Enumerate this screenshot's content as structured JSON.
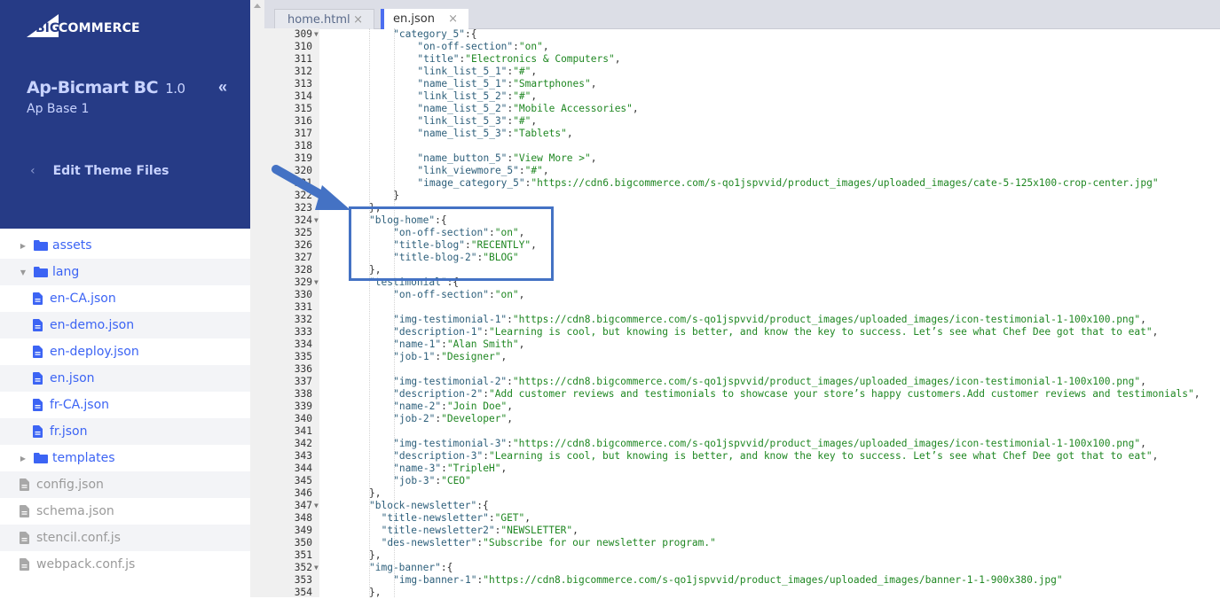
{
  "sidebar": {
    "logo_big": "BIG",
    "logo_text": "COMMERCE",
    "theme_name": "Ap-Bicmart BC",
    "theme_version": "1.0",
    "theme_variant": "Ap Base 1",
    "collapse_icon": "«",
    "back_icon": "‹",
    "edit_files_label": "Edit Theme Files",
    "tree": [
      {
        "label": "assets",
        "type": "folder",
        "expanded": false,
        "level": 0
      },
      {
        "label": "lang",
        "type": "folder",
        "expanded": true,
        "level": 0
      },
      {
        "label": "en-CA.json",
        "type": "file",
        "level": 1
      },
      {
        "label": "en-demo.json",
        "type": "file",
        "level": 1
      },
      {
        "label": "en-deploy.json",
        "type": "file",
        "level": 1
      },
      {
        "label": "en.json",
        "type": "file",
        "level": 1
      },
      {
        "label": "fr-CA.json",
        "type": "file",
        "level": 1
      },
      {
        "label": "fr.json",
        "type": "file",
        "level": 1
      },
      {
        "label": "templates",
        "type": "folder",
        "expanded": false,
        "level": 0
      },
      {
        "label": "config.json",
        "type": "file-muted",
        "level": -1
      },
      {
        "label": "schema.json",
        "type": "file-muted",
        "level": -1
      },
      {
        "label": "stencil.conf.js",
        "type": "file-muted",
        "level": -1
      },
      {
        "label": "webpack.conf.js",
        "type": "file-muted",
        "level": -1
      }
    ]
  },
  "editor": {
    "tabs": [
      {
        "label": "home.html",
        "active": false,
        "close": "×"
      },
      {
        "label": "en.json",
        "active": true,
        "close": "×"
      }
    ],
    "lines": [
      {
        "n": "309",
        "fold": true,
        "indent": 6,
        "key": "\"category_5\"",
        "rest": ":{"
      },
      {
        "n": "310",
        "indent": 7,
        "key": "\"on-off-section\"",
        "val": "\"on\"",
        "end": ","
      },
      {
        "n": "311",
        "indent": 7,
        "key": "\"title\"",
        "val": "\"Electronics & Computers\"",
        "end": ","
      },
      {
        "n": "312",
        "indent": 7,
        "key": "\"link_list_5_1\"",
        "val": "\"#\"",
        "end": ","
      },
      {
        "n": "313",
        "indent": 7,
        "key": "\"name_list_5_1\"",
        "val": "\"Smartphones\"",
        "end": ","
      },
      {
        "n": "314",
        "indent": 7,
        "key": "\"link_list_5_2\"",
        "val": "\"#\"",
        "end": ","
      },
      {
        "n": "315",
        "indent": 7,
        "key": "\"name_list_5_2\"",
        "val": "\"Mobile Accessories\"",
        "end": ","
      },
      {
        "n": "316",
        "indent": 7,
        "key": "\"link_list_5_3\"",
        "val": "\"#\"",
        "end": ","
      },
      {
        "n": "317",
        "indent": 7,
        "key": "\"name_list_5_3\"",
        "val": "\"Tablets\"",
        "end": ","
      },
      {
        "n": "318",
        "indent": 0,
        "rest": ""
      },
      {
        "n": "319",
        "indent": 7,
        "key": "\"name_button_5\"",
        "val": "\"View More >\"",
        "end": ","
      },
      {
        "n": "320",
        "indent": 7,
        "key": "\"link_viewmore_5\"",
        "val": "\"#\"",
        "end": ","
      },
      {
        "n": "321",
        "indent": 7,
        "key": "\"image_category_5\"",
        "val": "\"https://cdn6.bigcommerce.com/s-qo1jspvvid/product_images/uploaded_images/cate-5-125x100-crop-center.jpg\"",
        "end": ""
      },
      {
        "n": "322",
        "indent": 6,
        "rest": "}"
      },
      {
        "n": "323",
        "indent": 5,
        "rest": "},"
      },
      {
        "n": "324",
        "fold": true,
        "indent": 5,
        "key": "\"blog-home\"",
        "rest": ":{"
      },
      {
        "n": "325",
        "indent": 6,
        "key": "\"on-off-section\"",
        "val": "\"on\"",
        "end": ","
      },
      {
        "n": "326",
        "indent": 6,
        "key": "\"title-blog\"",
        "val": "\"RECENTLY\"",
        "end": ","
      },
      {
        "n": "327",
        "indent": 6,
        "key": "\"title-blog-2\"",
        "val": "\"BLOG\"",
        "end": ""
      },
      {
        "n": "328",
        "indent": 5,
        "rest": "},"
      },
      {
        "n": "329",
        "fold": true,
        "indent": 5,
        "key": "\"testimonial\"",
        "rest": ":{"
      },
      {
        "n": "330",
        "indent": 6,
        "key": "\"on-off-section\"",
        "val": "\"on\"",
        "end": ","
      },
      {
        "n": "331",
        "indent": 0,
        "rest": ""
      },
      {
        "n": "332",
        "indent": 6,
        "key": "\"img-testimonial-1\"",
        "val": "\"https://cdn8.bigcommerce.com/s-qo1jspvvid/product_images/uploaded_images/icon-testimonial-1-100x100.png\"",
        "end": ","
      },
      {
        "n": "333",
        "indent": 6,
        "key": "\"description-1\"",
        "val": "\"Learning is cool, but knowing is better, and know the key to success. Let’s see what Chef Dee got that to eat\"",
        "end": ","
      },
      {
        "n": "334",
        "indent": 6,
        "key": "\"name-1\"",
        "val": "\"Alan Smith\"",
        "end": ","
      },
      {
        "n": "335",
        "indent": 6,
        "key": "\"job-1\"",
        "val": "\"Designer\"",
        "end": ","
      },
      {
        "n": "336",
        "indent": 0,
        "rest": ""
      },
      {
        "n": "337",
        "indent": 6,
        "key": "\"img-testimonial-2\"",
        "val": "\"https://cdn8.bigcommerce.com/s-qo1jspvvid/product_images/uploaded_images/icon-testimonial-1-100x100.png\"",
        "end": ","
      },
      {
        "n": "338",
        "indent": 6,
        "key": "\"description-2\"",
        "val": "\"Add customer reviews and testimonials to showcase your store’s happy customers.Add customer reviews and testimonials\"",
        "end": ","
      },
      {
        "n": "339",
        "indent": 6,
        "key": "\"name-2\"",
        "val": "\"Join Doe\"",
        "end": ","
      },
      {
        "n": "340",
        "indent": 6,
        "key": "\"job-2\"",
        "val": "\"Developer\"",
        "end": ","
      },
      {
        "n": "341",
        "indent": 0,
        "rest": ""
      },
      {
        "n": "342",
        "indent": 6,
        "key": "\"img-testimonial-3\"",
        "val": "\"https://cdn8.bigcommerce.com/s-qo1jspvvid/product_images/uploaded_images/icon-testimonial-1-100x100.png\"",
        "end": ","
      },
      {
        "n": "343",
        "indent": 6,
        "key": "\"description-3\"",
        "val": "\"Learning is cool, but knowing is better, and know the key to success. Let’s see what Chef Dee got that to eat\"",
        "end": ","
      },
      {
        "n": "344",
        "indent": 6,
        "key": "\"name-3\"",
        "val": "\"TripleH\"",
        "end": ","
      },
      {
        "n": "345",
        "indent": 6,
        "key": "\"job-3\"",
        "val": "\"CEO\"",
        "end": ""
      },
      {
        "n": "346",
        "indent": 5,
        "rest": "},"
      },
      {
        "n": "347",
        "fold": true,
        "indent": 5,
        "key": "\"block-newsletter\"",
        "rest": ":{"
      },
      {
        "n": "348",
        "indent": 5.5,
        "key": "\"title-newsletter\"",
        "val": "\"GET\"",
        "end": ","
      },
      {
        "n": "349",
        "indent": 5.5,
        "key": "\"title-newsletter2\"",
        "val": "\"NEWSLETTER\"",
        "end": ","
      },
      {
        "n": "350",
        "indent": 5.5,
        "key": "\"des-newsletter\"",
        "val": "\"Subscribe for our newsletter program.\"",
        "end": ""
      },
      {
        "n": "351",
        "indent": 5,
        "rest": "},"
      },
      {
        "n": "352",
        "fold": true,
        "indent": 5,
        "key": "\"img-banner\"",
        "rest": ":{"
      },
      {
        "n": "353",
        "indent": 6,
        "key": "\"img-banner-1\"",
        "val": "\"https://cdn8.bigcommerce.com/s-qo1jspvvid/product_images/uploaded_images/banner-1-1-900x380.jpg\"",
        "end": ""
      },
      {
        "n": "354",
        "indent": 5,
        "rest": "},"
      }
    ]
  },
  "annotation": {
    "highlight_color": "#4472c4",
    "arrow_color": "#4472c4",
    "highlighted_block": "blog-home"
  },
  "colors": {
    "sidebar_bg": "#263b86",
    "tree_link": "#3c64f4",
    "tab_accent": "#4c6ef0",
    "string": "#1f8722",
    "key": "#2d5f7b"
  }
}
